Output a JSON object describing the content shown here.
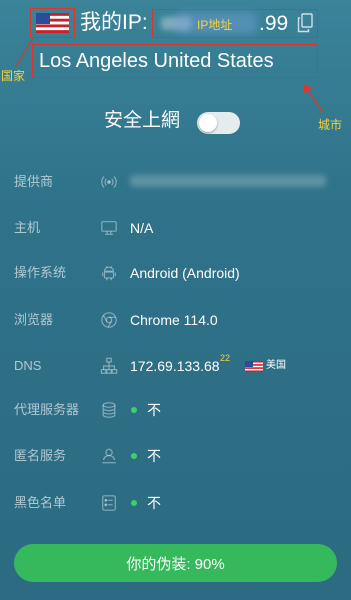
{
  "header": {
    "flag_icon": "us-flag-icon",
    "label": "我的IP:",
    "ip_suffix": ".99",
    "copy_icon": "copy-icon"
  },
  "location": {
    "text": "Los Angeles United States"
  },
  "annotations": {
    "country": "国家",
    "city": "城市",
    "ip": "IP地址",
    "box_color": "#e0342b",
    "label_color": "#f5d33a"
  },
  "safe_browsing": {
    "label": "安全上網",
    "enabled": false
  },
  "rows": [
    {
      "label": "提供商",
      "icon": "antenna-icon"
    },
    {
      "label": "主机",
      "icon": "monitor-icon",
      "value": "N/A"
    },
    {
      "label": "操作系统",
      "icon": "android-icon",
      "value": "Android (Android)"
    },
    {
      "label": "浏览器",
      "icon": "chrome-icon",
      "value": "Chrome 114.0"
    },
    {
      "label": "DNS",
      "icon": "network-icon",
      "value": "172.69.133.68",
      "superscript": "22",
      "flag_icon": "us-flag-icon",
      "country": "美国"
    },
    {
      "label": "代理服务器",
      "icon": "database-icon",
      "status": "不"
    },
    {
      "label": "匿名服务",
      "icon": "user-icon",
      "status": "不"
    },
    {
      "label": "黑色名单",
      "icon": "blacklist-icon",
      "status": "不"
    }
  ],
  "colors": {
    "status_ok": "#3ccf6e",
    "button": "#36b85c",
    "accent_yellow": "#f5d33a"
  },
  "disguise_button": {
    "label": "你的伪装: 90%"
  }
}
